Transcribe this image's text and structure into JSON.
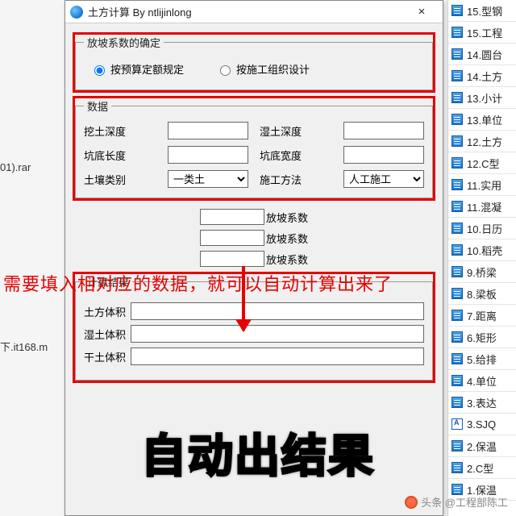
{
  "window": {
    "title": "土方计算 By ntlijinlong",
    "close": "×"
  },
  "group_coef": {
    "legend": "放坡系数的确定",
    "radio1": "按预算定额规定",
    "radio2": "按施工组织设计"
  },
  "group_data": {
    "legend": "数据",
    "dig_depth": "挖土深度",
    "wet_depth": "湿土深度",
    "pit_length": "坑底长度",
    "pit_width": "坑底宽度",
    "soil_type": "土壤类别",
    "soil_type_val": "一类土",
    "method": "施工方法",
    "method_val": "人工施工"
  },
  "slope_label": "放坡系数",
  "group_result": {
    "legend": "计算结果",
    "earth_vol": "土方体积",
    "wet_vol": "湿土体积",
    "dry_vol": "干土体积"
  },
  "sidelist": [
    "15.型钢",
    "15.工程",
    "14.圆台",
    "14.土方",
    "13.小计",
    "13.单位",
    "12.土方",
    "12.C型",
    "11.实用",
    "11.混凝",
    "10.日历",
    "10.稻壳",
    "9.桥梁",
    "8.梁板",
    "7.距离",
    "6.矩形",
    "5.给排",
    "4.单位",
    "3.表达",
    "3.SJQ",
    "2.保温",
    "2.C型",
    "1.保温"
  ],
  "bg_left": {
    "rar": "01).rar",
    "it168": "下.it168.m"
  },
  "annotation_red": "需要填入相对应的数据，就可以自动计算出来了",
  "big_caption": "自动出结果",
  "watermark": "头条 @工程部陈工"
}
